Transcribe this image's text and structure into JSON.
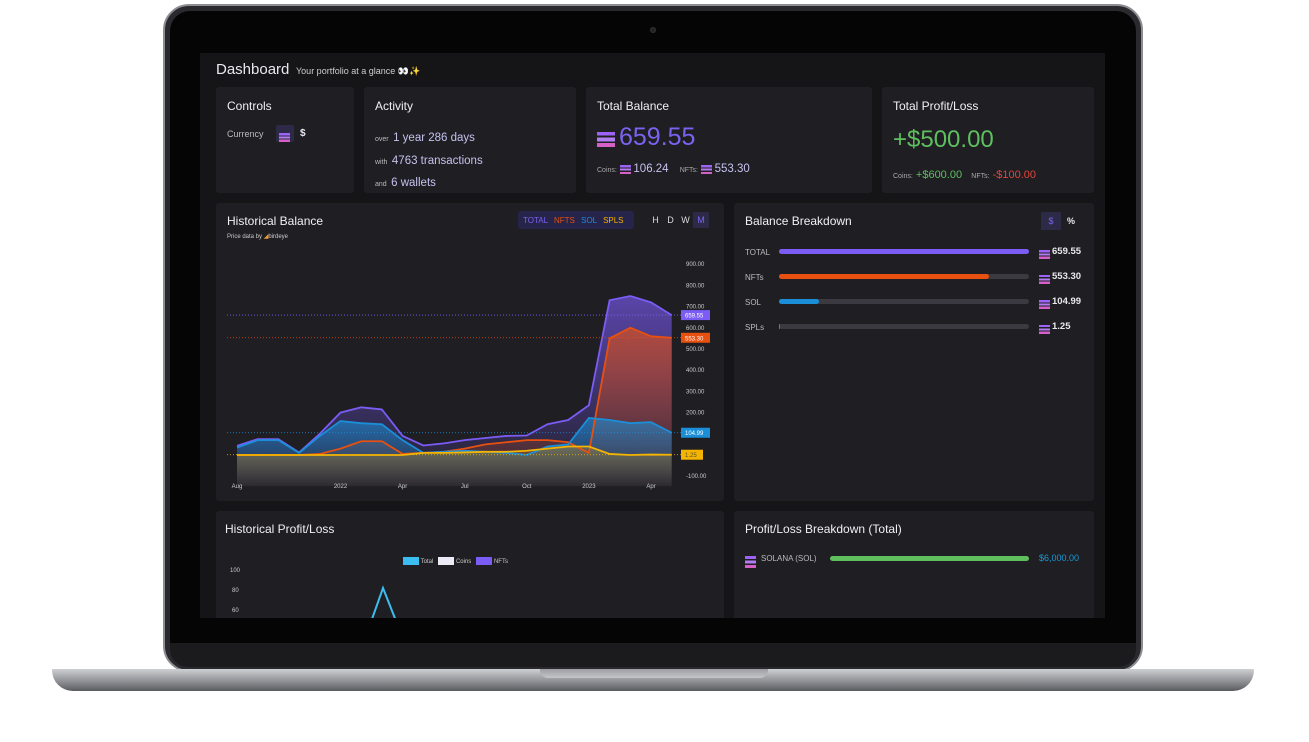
{
  "header": {
    "title": "Dashboard",
    "subtitle": "Your portfolio at a glance 👀✨"
  },
  "controls": {
    "title": "Controls",
    "currency_label": "Currency",
    "currency_options": [
      "SOL",
      "$"
    ],
    "selected": "SOL",
    "dollar": "$"
  },
  "activity": {
    "title": "Activity",
    "rows": [
      {
        "pre": "over",
        "text": "1 year 286 days"
      },
      {
        "pre": "with",
        "text": "4763 transactions"
      },
      {
        "pre": "and",
        "text": "6 wallets"
      }
    ]
  },
  "total_balance": {
    "title": "Total Balance",
    "value": "659.55",
    "coins_label": "Coins:",
    "coins": "106.24",
    "nfts_label": "NFTs:",
    "nfts": "553.30"
  },
  "total_pl": {
    "title": "Total Profit/Loss",
    "value": "+$500.00",
    "coins_label": "Coins:",
    "coins": "+$600.00",
    "nfts_label": "NFTs:",
    "nfts": "-$100.00"
  },
  "historical_balance": {
    "title": "Historical Balance",
    "price_by": "Price data by",
    "provider": "birdeye",
    "series_toggles": [
      "TOTAL",
      "NFTS",
      "SOL",
      "SPLS"
    ],
    "ranges": [
      "H",
      "D",
      "W",
      "M"
    ],
    "active_range": "M"
  },
  "balance_breakdown": {
    "title": "Balance Breakdown",
    "toggles": [
      "$",
      "%"
    ],
    "rows": [
      {
        "label": "TOTAL",
        "value": "659.55",
        "fraction": 1.0,
        "color": "#7b5cf5"
      },
      {
        "label": "NFTs",
        "value": "553.30",
        "fraction": 0.839,
        "color": "#e8500f"
      },
      {
        "label": "SOL",
        "value": "104.99",
        "fraction": 0.159,
        "color": "#1a8fd8"
      },
      {
        "label": "SPLs",
        "value": "1.25",
        "fraction": 0.002,
        "color": "#777"
      }
    ]
  },
  "historical_pl": {
    "title": "Historical Profit/Loss",
    "legend": [
      {
        "name": "Total",
        "color": "#3cbdf0"
      },
      {
        "name": "Coins",
        "color": "#ecebf5"
      },
      {
        "name": "NFTs",
        "color": "#7b5cf5"
      }
    ],
    "y_ticks": [
      "100",
      "80",
      "60"
    ]
  },
  "pl_breakdown": {
    "title": "Profit/Loss Breakdown (Total)",
    "rows": [
      {
        "label": "SOLANA (SOL)",
        "value": "$6,000.00",
        "fraction": 1.0
      }
    ]
  },
  "chart_data": {
    "type": "area",
    "x": [
      "2021-08",
      "2021-09",
      "2021-10",
      "2021-11",
      "2021-12",
      "2022-01",
      "2022-02",
      "2022-03",
      "2022-04",
      "2022-05",
      "2022-06",
      "2022-07",
      "2022-08",
      "2022-09",
      "2022-10",
      "2022-11",
      "2022-12",
      "2023-01",
      "2023-02",
      "2023-03",
      "2023-04",
      "2023-05"
    ],
    "x_ticks": [
      "Aug",
      "2022",
      "Apr",
      "Jul",
      "Oct",
      "2023",
      "Apr"
    ],
    "y_ticks": [
      "900.00",
      "800.00",
      "700.00",
      "600.00",
      "500.00",
      "400.00",
      "300.00",
      "200.00",
      "100.00",
      "-100.00"
    ],
    "ylim": [
      -100,
      900
    ],
    "series": [
      {
        "name": "TOTAL",
        "color": "#7b5cf5",
        "last": "659.55",
        "values": [
          43,
          75,
          75,
          12,
          100,
          200,
          225,
          215,
          90,
          45,
          55,
          70,
          80,
          90,
          92,
          145,
          165,
          235,
          730,
          750,
          720,
          660
        ]
      },
      {
        "name": "NFTS",
        "color": "#e8500f",
        "last": "553.30",
        "values": [
          0,
          0,
          0,
          0,
          5,
          30,
          65,
          65,
          5,
          10,
          15,
          30,
          50,
          60,
          70,
          70,
          60,
          10,
          550,
          600,
          560,
          553
        ]
      },
      {
        "name": "SOL",
        "color": "#1a8fd8",
        "last": "104.99",
        "values": [
          35,
          70,
          70,
          10,
          90,
          160,
          150,
          145,
          70,
          10,
          15,
          20,
          15,
          10,
          0,
          40,
          50,
          175,
          165,
          150,
          155,
          105
        ]
      },
      {
        "name": "SPLS",
        "color": "#f5b400",
        "last": "1.25",
        "values": [
          0,
          0,
          0,
          0,
          0,
          0,
          0,
          0,
          0,
          10,
          10,
          12,
          15,
          15,
          20,
          30,
          40,
          40,
          5,
          0,
          2,
          1.25
        ]
      }
    ]
  }
}
